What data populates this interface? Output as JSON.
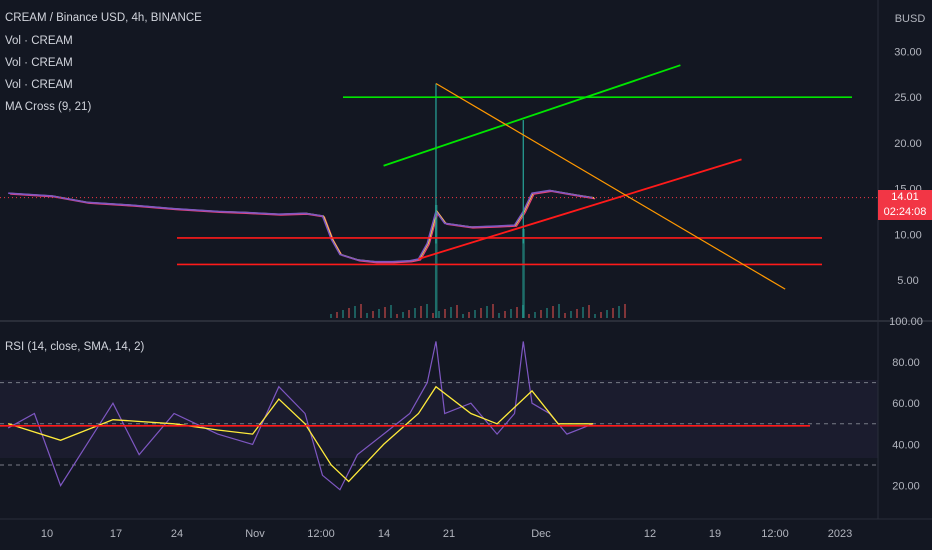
{
  "header": {
    "symbol_line": "CREAM / Binance USD, 4h, BINANCE",
    "volume_lines": [
      "Vol · CREAM",
      "Vol · CREAM",
      "Vol · CREAM"
    ],
    "ma_label": "MA Cross (9, 21)",
    "currency": "BUSD"
  },
  "price_tag": {
    "price": "14.01",
    "countdown": "02:24:08"
  },
  "rsi_panel": {
    "label": "RSI (14, close, SMA, 14, 2)"
  },
  "colors": {
    "background": "#131722",
    "price_line": "#7e57c2",
    "ma_fast": "#ffeb3b",
    "ma_slow": "#ec407a",
    "rsi_line": "#7e57c2",
    "rsi_ma": "#ffeb3b",
    "green_channel": "#00e600",
    "red_lines": "#ff1a1a",
    "orange_line": "#ff9800",
    "price_tag": "#f23645"
  },
  "chart_data": [
    {
      "type": "line",
      "title": "CREAM / Binance USD, 4h, BINANCE",
      "y_axis_label": "BUSD",
      "ylim": [
        2.5,
        32
      ],
      "y_ticks": [
        5,
        10,
        15,
        20,
        25,
        30
      ],
      "y_tick_labels": [
        "5.00",
        "10.00",
        "15.00",
        "20.00",
        "25.00",
        "30.00"
      ],
      "x_tick_labels": [
        "10",
        "17",
        "24",
        "Nov",
        "12:00",
        "14",
        "21",
        "Dec",
        "12",
        "19",
        "12:00",
        "2023"
      ],
      "series": [
        {
          "name": "MA Cross (9, 21)",
          "x": [
            "Oct 3",
            "Oct 8",
            "Oct 12",
            "Oct 17",
            "Oct 22",
            "Oct 27",
            "Oct 30",
            "Nov 3",
            "Nov 6",
            "Nov 8",
            "Nov 9",
            "Nov 10",
            "Nov 12",
            "Nov 14",
            "Nov 16",
            "Nov 18",
            "Nov 19",
            "Nov 20",
            "Nov 21",
            "Nov 22",
            "Nov 25",
            "Nov 28",
            "Nov 30",
            "Dec 1",
            "Dec 2",
            "Dec 4",
            "Dec 7",
            "Dec 9"
          ],
          "values": [
            14.5,
            14.2,
            13.5,
            13.2,
            12.8,
            12.5,
            12.4,
            12.2,
            12.3,
            12.0,
            9.5,
            7.8,
            7.2,
            7.0,
            7.0,
            7.1,
            7.3,
            9.0,
            12.5,
            11.2,
            10.8,
            10.9,
            11.0,
            12.5,
            14.5,
            14.8,
            14.3,
            14.0
          ]
        }
      ],
      "last_price": 14.01,
      "horizontal_lines": [
        25,
        9.6,
        6.7
      ],
      "trend_lines": [
        {
          "color": "green",
          "from": [
            "Nov 15",
            17.5
          ],
          "to": [
            "Dec 19",
            28.5
          ]
        },
        {
          "color": "red",
          "from": [
            "Nov 19",
            7.3
          ],
          "to": [
            "Dec 26",
            18.2
          ]
        },
        {
          "color": "orange",
          "from": [
            "Nov 21",
            26.5
          ],
          "to": [
            "Dec 31",
            4.0
          ]
        }
      ],
      "volume_spikes": [
        {
          "x": "Nov 21",
          "relative": 1.0
        },
        {
          "x": "Dec 1",
          "relative": 0.8
        }
      ]
    },
    {
      "type": "line",
      "title": "RSI (14, close, SMA, 14, 2)",
      "ylim": [
        10,
        100
      ],
      "y_ticks": [
        20,
        40,
        60,
        80,
        100
      ],
      "y_tick_labels": [
        "20.00",
        "40.00",
        "60.00",
        "80.00",
        "100.00"
      ],
      "bands": [
        30,
        50,
        70
      ],
      "series": [
        {
          "name": "RSI",
          "x": [
            "Oct 3",
            "Oct 6",
            "Oct 9",
            "Oct 12",
            "Oct 15",
            "Oct 18",
            "Oct 22",
            "Oct 27",
            "Oct 31",
            "Nov 3",
            "Nov 6",
            "Nov 8",
            "Nov 10",
            "Nov 12",
            "Nov 15",
            "Nov 18",
            "Nov 20",
            "Nov 21",
            "Nov 22",
            "Nov 25",
            "Nov 28",
            "Nov 30",
            "Dec 1",
            "Dec 2",
            "Dec 4",
            "Dec 6",
            "Dec 9"
          ],
          "values": [
            48,
            55,
            20,
            40,
            60,
            35,
            55,
            45,
            40,
            68,
            55,
            25,
            18,
            35,
            45,
            55,
            70,
            90,
            55,
            60,
            45,
            55,
            90,
            60,
            55,
            45,
            50
          ]
        },
        {
          "name": "RSI MA",
          "x": [
            "Oct 3",
            "Oct 9",
            "Oct 15",
            "Oct 22",
            "Oct 27",
            "Oct 31",
            "Nov 3",
            "Nov 6",
            "Nov 9",
            "Nov 11",
            "Nov 15",
            "Nov 19",
            "Nov 21",
            "Nov 25",
            "Nov 28",
            "Dec 2",
            "Dec 5",
            "Dec 9"
          ],
          "values": [
            50,
            42,
            52,
            50,
            47,
            45,
            62,
            50,
            30,
            22,
            40,
            55,
            68,
            55,
            50,
            66,
            50,
            50
          ]
        }
      ],
      "horizontal_lines": [
        49
      ]
    }
  ]
}
